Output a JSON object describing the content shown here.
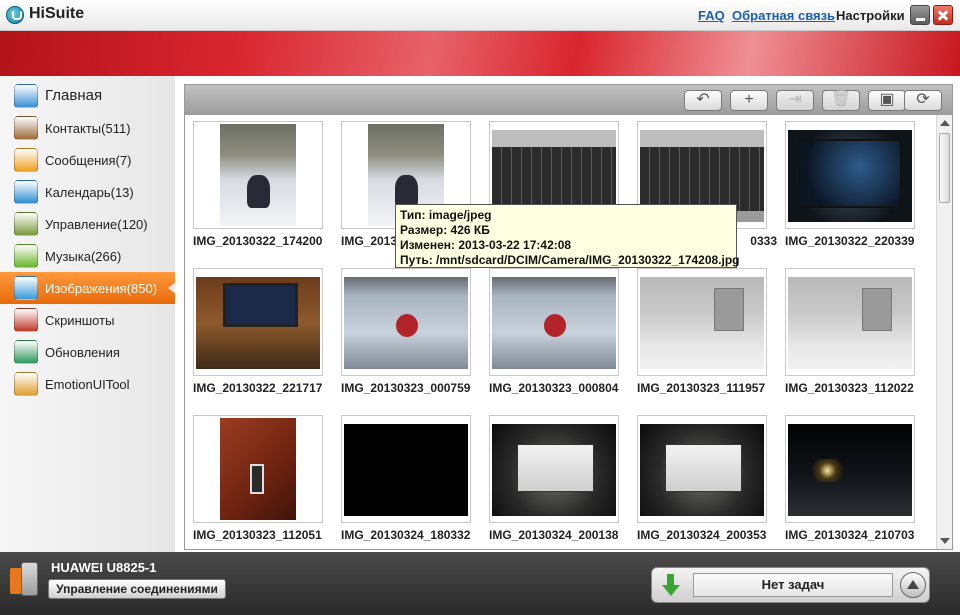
{
  "app": {
    "title": "HiSuite"
  },
  "top_links": {
    "faq": "FAQ",
    "feedback": "Обратная связь",
    "settings": "Настройки"
  },
  "sidebar": {
    "items": [
      {
        "label": "Главная",
        "icon": "home-icon"
      },
      {
        "label": "Контакты(511)",
        "icon": "contacts-icon"
      },
      {
        "label": "Сообщения(7)",
        "icon": "messages-icon"
      },
      {
        "label": "Календарь(13)",
        "icon": "calendar-icon"
      },
      {
        "label": "Управление(120)",
        "icon": "apps-icon"
      },
      {
        "label": "Музыка(266)",
        "icon": "music-icon"
      },
      {
        "label": "Изображения(850)",
        "icon": "images-icon",
        "active": true
      },
      {
        "label": "Скриншоты",
        "icon": "screenshot-icon"
      },
      {
        "label": "Обновления",
        "icon": "update-icon"
      },
      {
        "label": "EmotionUITool",
        "icon": "emotionui-icon"
      }
    ]
  },
  "toolbar": {
    "buttons": [
      {
        "icon": "undo-icon",
        "glyph": "↶",
        "enabled": true
      },
      {
        "icon": "add-icon",
        "glyph": "+",
        "enabled": true
      },
      {
        "icon": "export-icon",
        "glyph": "⇥",
        "enabled": false
      },
      {
        "icon": "delete-icon",
        "glyph": "🗑",
        "enabled": false
      },
      {
        "icon": "wallpaper-icon",
        "glyph": "▣",
        "enabled": true
      },
      {
        "icon": "refresh-icon",
        "glyph": "⟳",
        "enabled": true
      }
    ]
  },
  "photos": [
    {
      "name": "IMG_20130322_174200",
      "style": "snow",
      "portrait": true
    },
    {
      "name": "IMG_2013",
      "style": "snow",
      "portrait": true
    },
    {
      "name": "",
      "style": "kb",
      "portrait": false
    },
    {
      "name": "0333",
      "style": "kb",
      "portrait": false
    },
    {
      "name": "IMG_20130322_220339",
      "style": "desk",
      "portrait": false
    },
    {
      "name": "IMG_20130322_221717",
      "style": "laptop",
      "portrait": false
    },
    {
      "name": "IMG_20130323_000759",
      "style": "fridge",
      "portrait": false
    },
    {
      "name": "IMG_20130323_000804",
      "style": "fridge",
      "portrait": false
    },
    {
      "name": "IMG_20130323_111957",
      "style": "city",
      "portrait": false
    },
    {
      "name": "IMG_20130323_112022",
      "style": "city",
      "portrait": false
    },
    {
      "name": "IMG_20130323_112051",
      "style": "phone",
      "portrait": true
    },
    {
      "name": "IMG_20130324_180332",
      "style": "black",
      "portrait": false
    },
    {
      "name": "IMG_20130324_200138",
      "style": "screen",
      "portrait": false
    },
    {
      "name": "IMG_20130324_200353",
      "style": "screen",
      "portrait": false
    },
    {
      "name": "IMG_20130324_210703",
      "style": "night",
      "portrait": false
    }
  ],
  "tooltip": {
    "type": "Тип: image/jpeg",
    "size": "Размер: 426 КБ",
    "modified": "Изменен: 2013-03-22 17:42:08",
    "path": "Путь: /mnt/sdcard/DCIM/Camera/IMG_20130322_174208.jpg"
  },
  "device": {
    "name": "HUAWEI U8825-1",
    "connection_button": "Управление соединениями"
  },
  "tasks": {
    "status": "Нет задач"
  },
  "colors": {
    "accent": "#e86a0a",
    "banner": "#c8161f",
    "link": "#1a5fb4"
  }
}
